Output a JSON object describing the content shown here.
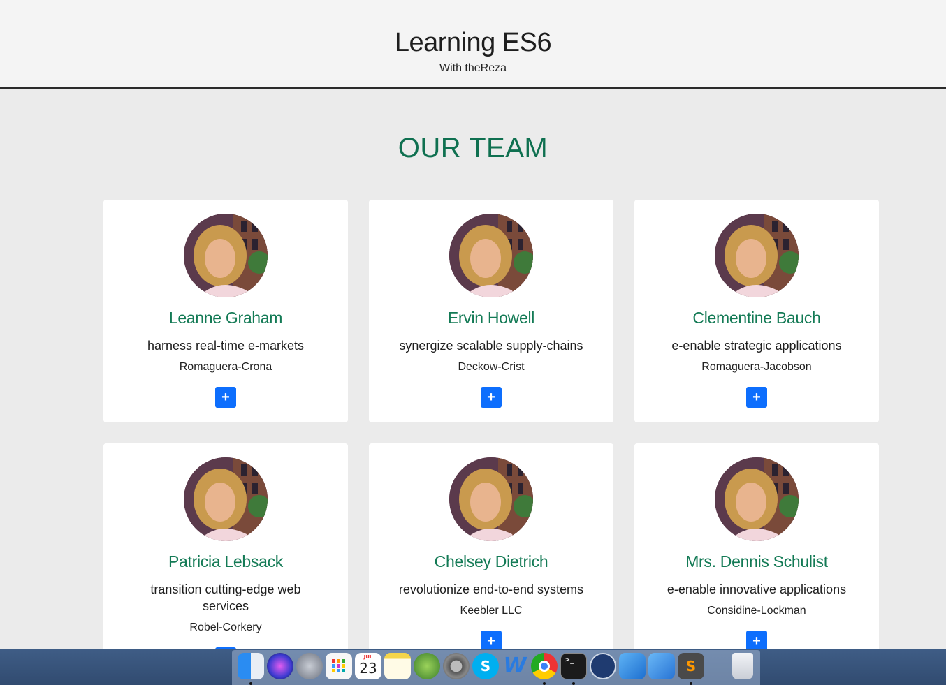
{
  "header": {
    "title": "Learning ES6",
    "subtitle": "With theReza"
  },
  "section": {
    "title": "OUR TEAM"
  },
  "team": [
    {
      "name": "Leanne Graham",
      "catch_phrase": "harness real-time e-markets",
      "company": "Romaguera-Crona",
      "add_label": "+"
    },
    {
      "name": "Ervin Howell",
      "catch_phrase": "synergize scalable supply-chains",
      "company": "Deckow-Crist",
      "add_label": "+"
    },
    {
      "name": "Clementine Bauch",
      "catch_phrase": "e-enable strategic applications",
      "company": "Romaguera-Jacobson",
      "add_label": "+"
    },
    {
      "name": "Patricia Lebsack",
      "catch_phrase": "transition cutting-edge web services",
      "company": "Robel-Corkery",
      "add_label": "+"
    },
    {
      "name": "Chelsey Dietrich",
      "catch_phrase": "revolutionize end-to-end systems",
      "company": "Keebler LLC",
      "add_label": "+"
    },
    {
      "name": "Mrs. Dennis Schulist",
      "catch_phrase": "e-enable innovative applications",
      "company": "Considine-Lockman",
      "add_label": "+"
    }
  ],
  "colors": {
    "accent": "#137a55",
    "button": "#0d6efd",
    "background": "#ebebeb"
  },
  "dock": {
    "calendar_month": "JUL",
    "calendar_day": "23",
    "items": [
      {
        "icon": "finder-icon"
      },
      {
        "icon": "siri-icon"
      },
      {
        "icon": "launchpad-icon"
      },
      {
        "icon": "app-grid-icon"
      },
      {
        "icon": "calendar-icon"
      },
      {
        "icon": "notes-icon"
      },
      {
        "icon": "android-studio-icon"
      },
      {
        "icon": "system-preferences-icon"
      },
      {
        "icon": "skype-icon",
        "glyph": "S"
      },
      {
        "icon": "word-icon",
        "glyph": "W"
      },
      {
        "icon": "chrome-icon"
      },
      {
        "icon": "terminal-icon",
        "glyph": ">_"
      },
      {
        "icon": "sourcetree-icon"
      },
      {
        "icon": "xcode-icon"
      },
      {
        "icon": "simulator-icon"
      },
      {
        "icon": "sublime-text-icon",
        "glyph": "S"
      },
      {
        "icon": "trash-icon"
      }
    ]
  }
}
